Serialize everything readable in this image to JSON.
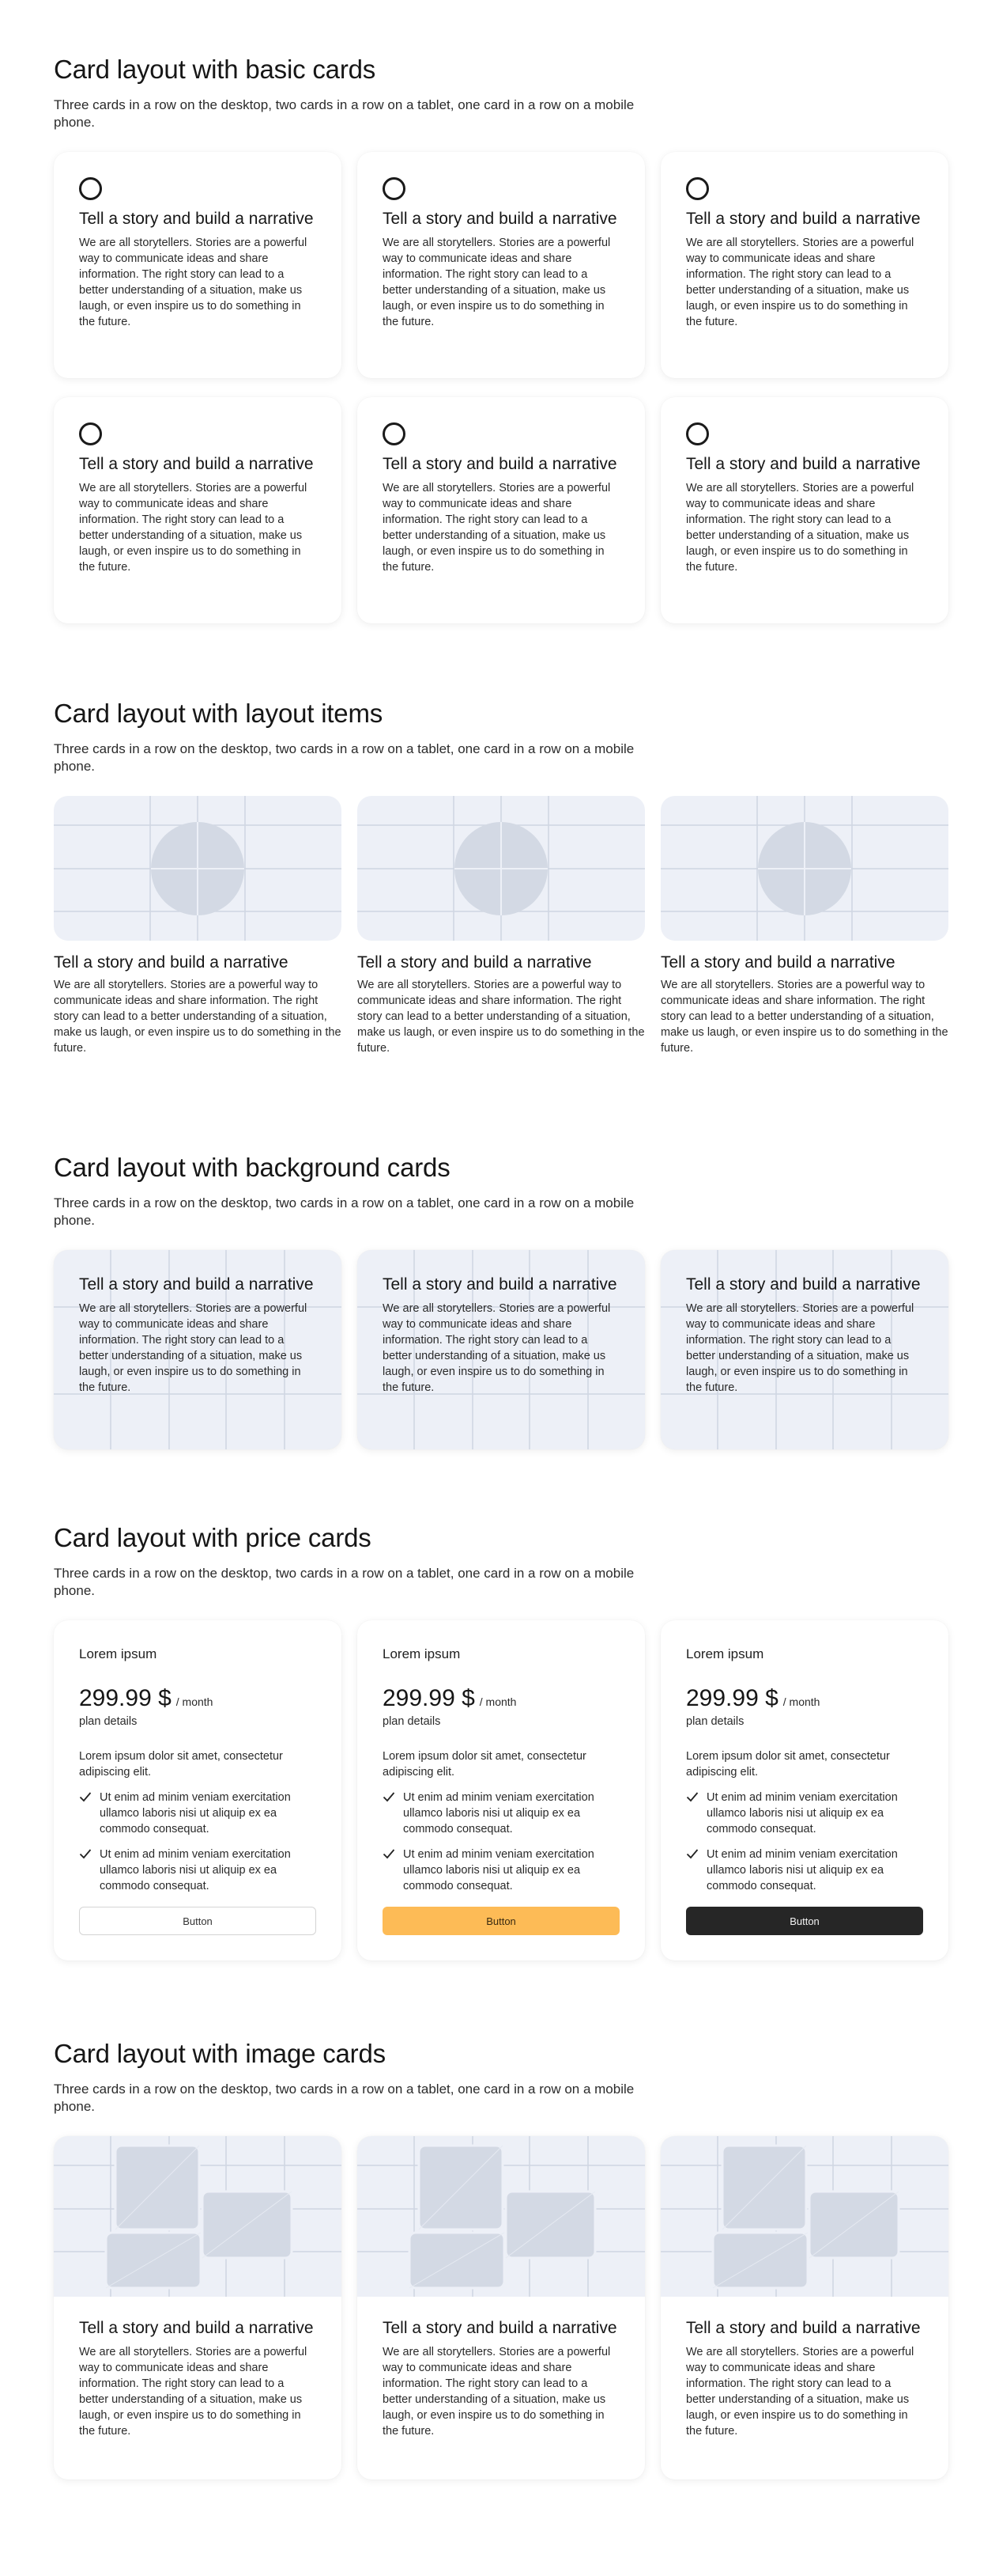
{
  "sections": {
    "basic": {
      "title": "Card layout with basic cards",
      "description": "Three cards in a row on the desktop, two cards in a row on a tablet, one card in a row on a mobile phone.",
      "cards": [
        {
          "icon": "circle-icon",
          "title": "Tell a story and build a narrative",
          "text": "We are all storytellers. Stories are a powerful way to communicate ideas and share information. The right story can lead to a better understanding of a situation, make us laugh, or even inspire us to do something in the future."
        },
        {
          "icon": "circle-icon",
          "title": "Tell a story and build a narrative",
          "text": "We are all storytellers. Stories are a powerful way to communicate ideas and share information. The right story can lead to a better understanding of a situation, make us laugh, or even inspire us to do something in the future."
        },
        {
          "icon": "circle-icon",
          "title": "Tell a story and build a narrative",
          "text": "We are all storytellers. Stories are a powerful way to communicate ideas and share information. The right story can lead to a better understanding of a situation, make us laugh, or even inspire us to do something in the future."
        },
        {
          "icon": "circle-icon",
          "title": "Tell a story and build a narrative",
          "text": "We are all storytellers. Stories are a powerful way to communicate ideas and share information. The right story can lead to a better understanding of a situation, make us laugh, or even inspire us to do something in the future."
        },
        {
          "icon": "circle-icon",
          "title": "Tell a story and build a narrative",
          "text": "We are all storytellers. Stories are a powerful way to communicate ideas and share information. The right story can lead to a better understanding of a situation, make us laugh, or even inspire us to do something in the future."
        },
        {
          "icon": "circle-icon",
          "title": "Tell a story and build a narrative",
          "text": "We are all storytellers. Stories are a powerful way to communicate ideas and share information. The right story can lead to a better understanding of a situation, make us laugh, or even inspire us to do something in the future."
        }
      ]
    },
    "layout_items": {
      "title": "Card layout with layout items",
      "description": "Three cards in a row on the desktop, two cards in a row on a tablet, one card in a row on a mobile phone.",
      "cards": [
        {
          "image": "placeholder-image",
          "title": "Tell a story and build a narrative",
          "text": "We are all storytellers. Stories are a powerful way to communicate ideas and share information. The right story can lead to a better understanding of a situation, make us laugh, or even inspire us to do something in the future."
        },
        {
          "image": "placeholder-image",
          "title": "Tell a story and build a narrative",
          "text": "We are all storytellers. Stories are a powerful way to communicate ideas and share information. The right story can lead to a better understanding of a situation, make us laugh, or even inspire us to do something in the future."
        },
        {
          "image": "placeholder-image",
          "title": "Tell a story and build a narrative",
          "text": "We are all storytellers. Stories are a powerful way to communicate ideas and share information. The right story can lead to a better understanding of a situation, make us laugh, or even inspire us to do something in the future."
        }
      ]
    },
    "background": {
      "title": "Card layout with background cards",
      "description": "Three cards in a row on the desktop, two cards in a row on a tablet, one card in a row on a mobile phone.",
      "cards": [
        {
          "title": "Tell a story and build a narrative",
          "text": "We are all storytellers. Stories are a powerful way to communicate ideas and share information. The right story can lead to a better understanding of a situation, make us laugh, or even inspire us to do something in the future."
        },
        {
          "title": "Tell a story and build a narrative",
          "text": "We are all storytellers. Stories are a powerful way to communicate ideas and share information. The right story can lead to a better understanding of a situation, make us laugh, or even inspire us to do something in the future."
        },
        {
          "title": "Tell a story and build a narrative",
          "text": "We are all storytellers. Stories are a powerful way to communicate ideas and share information. The right story can lead to a better understanding of a situation, make us laugh, or even inspire us to do something in the future."
        }
      ]
    },
    "price": {
      "title": "Card layout with price cards",
      "description": "Three cards in a row on the desktop, two cards in a row on a tablet, one card in a row on a mobile phone.",
      "cards": [
        {
          "name": "Lorem ipsum",
          "amount": "299.99 $",
          "period": "/ month",
          "details": "plan details",
          "description": "Lorem ipsum dolor sit amet, consectetur adipiscing elit.",
          "features": [
            "Ut enim ad minim veniam exercitation ullamco laboris nisi ut aliquip ex ea commodo consequat.",
            "Ut enim ad minim veniam exercitation ullamco laboris nisi ut aliquip ex ea commodo consequat."
          ],
          "button": "Button",
          "button_style": "outline"
        },
        {
          "name": "Lorem ipsum",
          "amount": "299.99 $",
          "period": "/ month",
          "details": "plan details",
          "description": "Lorem ipsum dolor sit amet, consectetur adipiscing elit.",
          "features": [
            "Ut enim ad minim veniam exercitation ullamco laboris nisi ut aliquip ex ea commodo consequat.",
            "Ut enim ad minim veniam exercitation ullamco laboris nisi ut aliquip ex ea commodo consequat."
          ],
          "button": "Button",
          "button_style": "yellow"
        },
        {
          "name": "Lorem ipsum",
          "amount": "299.99 $",
          "period": "/ month",
          "details": "plan details",
          "description": "Lorem ipsum dolor sit amet, consectetur adipiscing elit.",
          "features": [
            "Ut enim ad minim veniam exercitation ullamco laboris nisi ut aliquip ex ea commodo consequat.",
            "Ut enim ad minim veniam exercitation ullamco laboris nisi ut aliquip ex ea commodo consequat."
          ],
          "button": "Button",
          "button_style": "dark"
        }
      ]
    },
    "image": {
      "title": "Card layout with image cards",
      "description": "Three cards in a row on the desktop, two cards in a row on a tablet, one card in a row on a mobile phone.",
      "cards": [
        {
          "image": "image-placeholder",
          "title": "Tell a story and build a narrative",
          "text": "We are all storytellers. Stories are a powerful way to communicate ideas and share information. The right story can lead to a better understanding of a situation, make us laugh, or even inspire us to do something in the future."
        },
        {
          "image": "image-placeholder",
          "title": "Tell a story and build a narrative",
          "text": "We are all storytellers. Stories are a powerful way to communicate ideas and share information. The right story can lead to a better understanding of a situation, make us laugh, or even inspire us to do something in the future."
        },
        {
          "image": "image-placeholder",
          "title": "Tell a story and build a narrative",
          "text": "We are all storytellers. Stories are a powerful way to communicate ideas and share information. The right story can lead to a better understanding of a situation, make us laugh, or even inspire us to do something in the future."
        }
      ]
    }
  },
  "colors": {
    "placeholder_bg": "#edf0f7",
    "placeholder_shape": "#d3d9e4",
    "grid_line": "#cfd5e2",
    "accent_button": "#fdbb56",
    "dark_button": "#262626"
  }
}
